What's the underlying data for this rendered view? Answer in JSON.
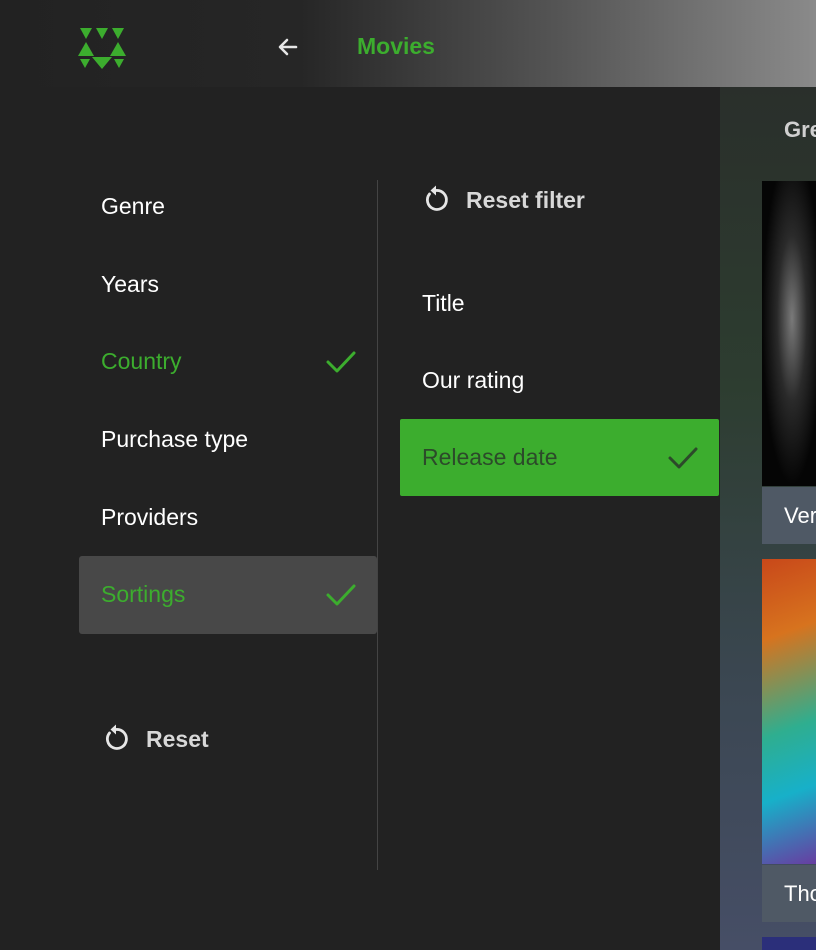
{
  "header": {
    "title": "Movies"
  },
  "filters": {
    "items": [
      {
        "label": "Genre",
        "selected": false
      },
      {
        "label": "Years",
        "selected": false
      },
      {
        "label": "Country",
        "selected": true
      },
      {
        "label": "Purchase type",
        "selected": false
      },
      {
        "label": "Providers",
        "selected": false
      },
      {
        "label": "Sortings",
        "selected": true,
        "focused": true
      }
    ],
    "reset_label": "Reset"
  },
  "sorting": {
    "reset_filter_label": "Reset filter",
    "options": [
      {
        "label": "Title",
        "active": false
      },
      {
        "label": "Our rating",
        "active": false
      },
      {
        "label": "Release date",
        "active": true
      }
    ]
  },
  "content": {
    "heading": "Gre",
    "posters": [
      {
        "caption": "Ver"
      },
      {
        "caption": "Tho"
      }
    ]
  },
  "colors": {
    "accent": "#3cad2e",
    "background": "#222222",
    "focus_bg": "#484848"
  },
  "icons": {
    "logo": "brand-logo-triangles",
    "back": "arrow-left-icon",
    "check": "check-icon",
    "reset": "rotate-ccw-icon"
  }
}
